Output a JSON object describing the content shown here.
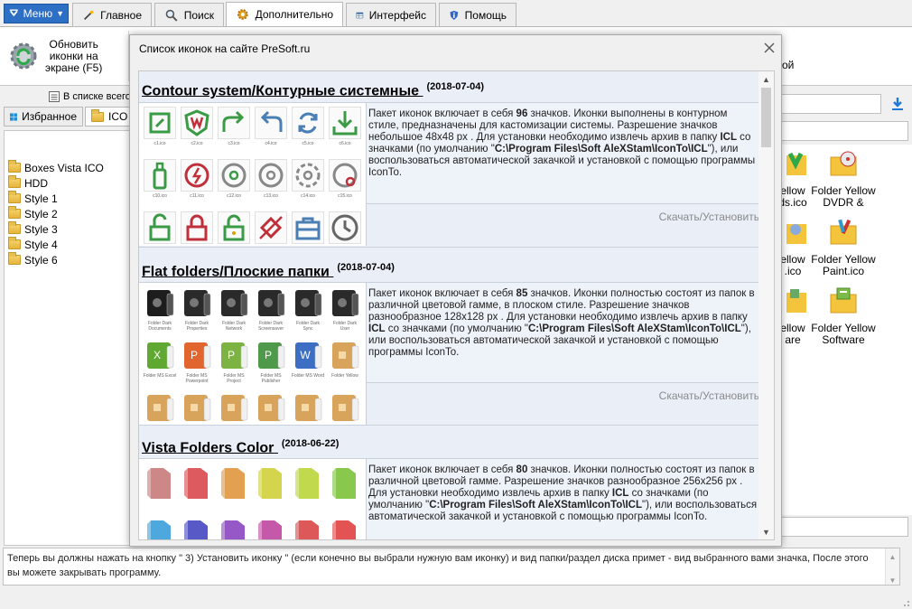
{
  "menu": {
    "label": "Меню"
  },
  "tabs": [
    {
      "label": "Главное"
    },
    {
      "label": "Поиск"
    },
    {
      "label": "Дополнительно"
    },
    {
      "label": "Интерфейс"
    },
    {
      "label": "Помощь"
    }
  ],
  "ribbon": {
    "update_label_1": "Обновить",
    "update_label_2": "иконки на",
    "update_label_3": "экране (F5)",
    "right_fragment": "ой"
  },
  "left": {
    "list_label": "В списке всего",
    "tab_favorites": "Избранное",
    "tab_ico": "ICO",
    "tree": [
      "Boxes Vista ICO",
      "HDD",
      "Style 1",
      "Style 2",
      "Style 3",
      "Style 4",
      "Style 6"
    ]
  },
  "right": {
    "icons": [
      {
        "label_1": "ellow",
        "label_2": "ds.ico"
      },
      {
        "label_1": "Folder Yellow",
        "label_2": "DVDR &"
      },
      {
        "label_1": "ellow",
        "label_2": ".ico"
      },
      {
        "label_1": "Folder Yellow",
        "label_2": "Paint.ico"
      },
      {
        "label_1": "ellow",
        "label_2": "are"
      },
      {
        "label_1": "Folder Yellow",
        "label_2": "Software"
      }
    ]
  },
  "dialog": {
    "title": "Список иконок на сайте PreSoft.ru",
    "packs": [
      {
        "title": "Contour system/Контурные системные",
        "date": "(2018-07-04)",
        "desc_a": "Пакет иконок включает в себя ",
        "count": "96",
        "desc_b": " значков. Иконки выполнены в контурном стиле, предназначены для кастомизации системы. Разрешение значков небольшое 48x48 px . Для установки необходимо извлечь архив в папку ",
        "icl": "ICL",
        "desc_c": " со значками (по умолчанию \"",
        "path": "C:\\Program Files\\Soft AleXStam\\IconTo\\ICL",
        "desc_d": "\"), или воспользоваться автоматической закачкой и установкой с помощью программы IconTo.",
        "download": "Скачать/Установить",
        "captions": [
          "c1.ico",
          "c2.ico",
          "c3.ico",
          "c4.ico",
          "c5.ico",
          "c6.ico",
          "c10.ico",
          "c11.ico",
          "c12.ico",
          "c13.ico",
          "c14.ico",
          "c15.ico",
          "",
          "",
          "",
          "",
          "",
          ""
        ]
      },
      {
        "title": "Flat folders/Плоские папки",
        "date": "(2018-07-04)",
        "desc_a": "Пакет иконок включает в себя ",
        "count": "85",
        "desc_b": " значков. Иконки полностью состоят из папок в различной цветовой гамме, в плоском стиле. Разрешение значков разнообразное 128x128 px . Для установки необходимо извлечь архив в папку ",
        "icl": "ICL",
        "desc_c": " со значками (по умолчанию \"",
        "path": "C:\\Program Files\\Soft AleXStam\\IconTo\\ICL",
        "desc_d": "\"), или воспользоваться автоматической закачкой и установкой с помощью программы IconTo.",
        "download": "Скачать/Установить",
        "captions": [
          "Folder Dark Documents",
          "Folder Dark Properties",
          "Folder Dark Network",
          "Folder Dark Screensaver",
          "Folder Dark Sync",
          "Folder Dark User",
          "Folder MS Excel",
          "Folder MS Powerpoint",
          "Folder MS Project",
          "Folder MS Publisher",
          "Folder MS Word",
          "Folder Yellow",
          "",
          "",
          "",
          "",
          "",
          ""
        ]
      },
      {
        "title": "Vista Folders Color",
        "date": "(2018-06-22)",
        "desc_a": "Пакет иконок включает в себя ",
        "count": "80",
        "desc_b": " значков. Иконки полностью состоят из папок в различной цветовой гамме. Разрешение значков разнообразное 256x256 px . Для установки необходимо извлечь архив в папку ",
        "icl": "ICL",
        "desc_c": " со значками (по умолчанию \"",
        "path": "C:\\Program Files\\Soft AleXStam\\IconTo\\ICL",
        "desc_d": "\"), или воспользоваться автоматической закачкой и установкой с помощью программы IconTo.",
        "captions": [
          "",
          "",
          "",
          "",
          "",
          "",
          "",
          "",
          "",
          "",
          "",
          ""
        ]
      }
    ]
  },
  "status": {
    "text": "Теперь вы должны нажать на кнопку \" 3)  Установить иконку \" (если конечно вы выбрали нужную вам иконку) и вид папки/раздел диска примет - вид выбранного вами значка, После этого вы можете закрывать программу."
  },
  "colors": {
    "menu_blue": "#2c6fc4",
    "contour_green": "#3a9a45",
    "contour_red": "#c0303a",
    "contour_blue": "#4a7fb5",
    "pack_bg": "#e9eef7"
  }
}
